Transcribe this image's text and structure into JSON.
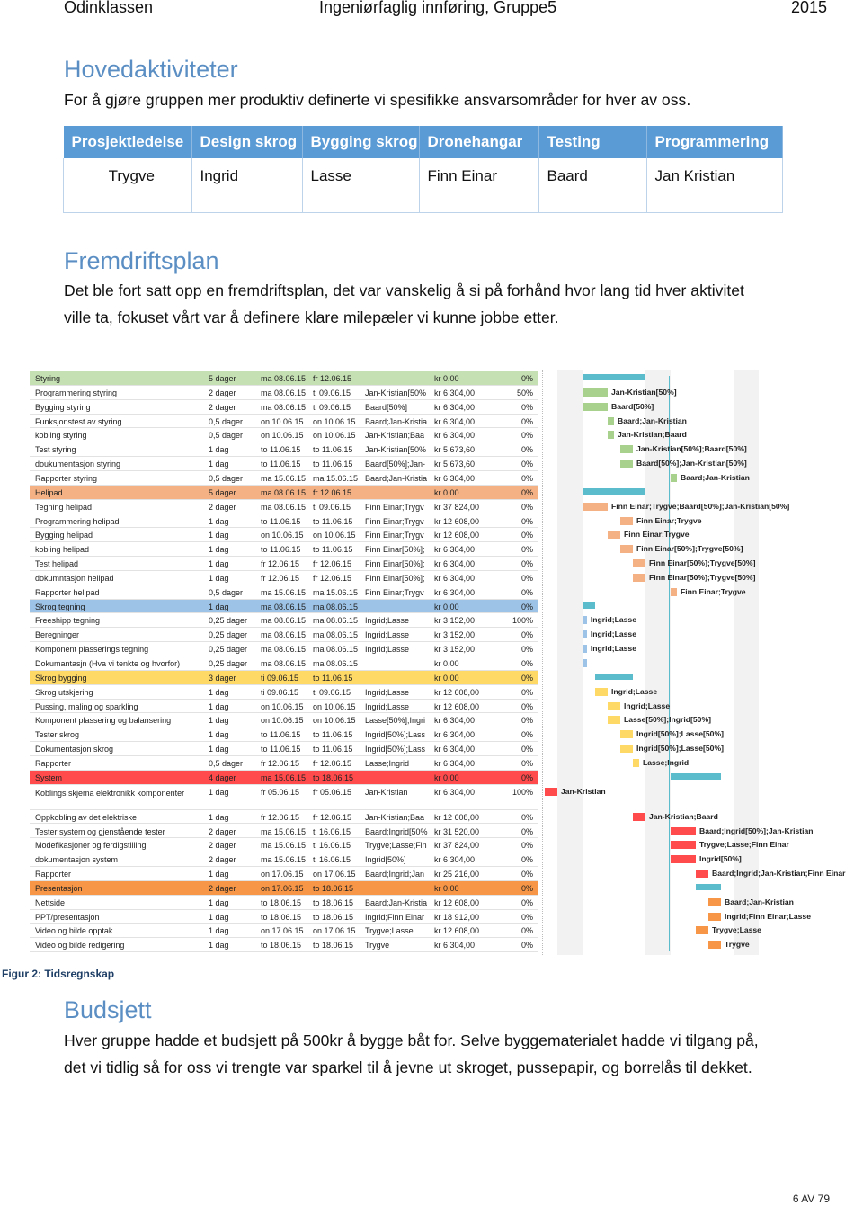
{
  "header": {
    "left": "Odinklassen",
    "center": "Ingeniørfaglig innføring, Gruppe5",
    "right": "2015"
  },
  "section1": {
    "title": "Hovedaktiviteter",
    "text": "For å gjøre gruppen mer produktiv definerte vi spesifikke ansvarsområder for hver av oss.",
    "table": {
      "headers": [
        "Prosjektledelse",
        "Design skrog",
        "Bygging skrog",
        "Dronehangar",
        "Testing",
        "Programmering"
      ],
      "values": [
        "Trygve",
        "Ingrid",
        "Lasse",
        "Finn Einar",
        "Baard",
        "Jan Kristian"
      ]
    }
  },
  "section2": {
    "title": "Fremdriftsplan",
    "lines": [
      "Det ble fort satt opp en fremdriftsplan, det var vanskelig å si på forhånd hvor lang tid hver aktivitet",
      "ville ta, fokuset vårt var å definere klare milepæler vi kunne jobbe etter."
    ]
  },
  "figure": {
    "caption": "Figur 2: Tidsregnskap"
  },
  "chart_data": {
    "type": "table",
    "colors": {
      "green": "#a9d18e",
      "orange": "#f4b183",
      "blue": "#9dc3e6",
      "yellow": "#ffd966",
      "red": "#ff4b4b",
      "darkorange": "#f79646",
      "summary_bar": "#5bbccb"
    },
    "rows": [
      {
        "name": "Styring",
        "dur": "5 dager",
        "start": "ma 08.06.15",
        "finish": "fr 12.06.15",
        "res": "",
        "cost": "kr 0,00",
        "pct": "0%",
        "summary": true,
        "group": "green",
        "label": ""
      },
      {
        "name": "Programmering styring",
        "dur": "2 dager",
        "start": "ma 08.06.15",
        "finish": "ti 09.06.15",
        "res": "Jan-Kristian[50%",
        "cost": "kr 6 304,00",
        "pct": "50%",
        "group": "green",
        "label": "Jan-Kristian[50%]"
      },
      {
        "name": "Bygging styring",
        "dur": "2 dager",
        "start": "ma 08.06.15",
        "finish": "ti 09.06.15",
        "res": "Baard[50%]",
        "cost": "kr 6 304,00",
        "pct": "0%",
        "group": "green",
        "label": "Baard[50%]"
      },
      {
        "name": "Funksjonstest av styring",
        "dur": "0,5 dager",
        "start": "on 10.06.15",
        "finish": "on 10.06.15",
        "res": "Baard;Jan-Kristia",
        "cost": "kr 6 304,00",
        "pct": "0%",
        "group": "green",
        "label": "Baard;Jan-Kristian"
      },
      {
        "name": "kobling styring",
        "dur": "0,5 dager",
        "start": "on 10.06.15",
        "finish": "on 10.06.15",
        "res": "Jan-Kristian;Baa",
        "cost": "kr 6 304,00",
        "pct": "0%",
        "group": "green",
        "label": "Jan-Kristian;Baard"
      },
      {
        "name": "Test styring",
        "dur": "1 dag",
        "start": "to 11.06.15",
        "finish": "to 11.06.15",
        "res": "Jan-Kristian[50%",
        "cost": "kr 5 673,60",
        "pct": "0%",
        "group": "green",
        "label": "Jan-Kristian[50%];Baard[50%]"
      },
      {
        "name": "doukumentasjon styring",
        "dur": "1 dag",
        "start": "to 11.06.15",
        "finish": "to 11.06.15",
        "res": "Baard[50%];Jan-",
        "cost": "kr 5 673,60",
        "pct": "0%",
        "group": "green",
        "label": "Baard[50%];Jan-Kristian[50%]"
      },
      {
        "name": "Rapporter styring",
        "dur": "0,5 dager",
        "start": "ma 15.06.15",
        "finish": "ma 15.06.15",
        "res": "Baard;Jan-Kristia",
        "cost": "kr 6 304,00",
        "pct": "0%",
        "group": "green",
        "label": "Baard;Jan-Kristian"
      },
      {
        "name": "Helipad",
        "dur": "5 dager",
        "start": "ma 08.06.15",
        "finish": "fr 12.06.15",
        "res": "",
        "cost": "kr 0,00",
        "pct": "0%",
        "summary": true,
        "group": "orange",
        "label": ""
      },
      {
        "name": "Tegning helipad",
        "dur": "2 dager",
        "start": "ma 08.06.15",
        "finish": "ti 09.06.15",
        "res": "Finn Einar;Trygv",
        "cost": "kr 37 824,00",
        "pct": "0%",
        "group": "orange",
        "label": "Finn Einar;Trygve;Baard[50%];Jan-Kristian[50%]"
      },
      {
        "name": "Programmering helipad",
        "dur": "1 dag",
        "start": "to 11.06.15",
        "finish": "to 11.06.15",
        "res": "Finn Einar;Trygv",
        "cost": "kr 12 608,00",
        "pct": "0%",
        "group": "orange",
        "label": "Finn Einar;Trygve"
      },
      {
        "name": "Bygging helipad",
        "dur": "1 dag",
        "start": "on 10.06.15",
        "finish": "on 10.06.15",
        "res": "Finn Einar;Trygv",
        "cost": "kr 12 608,00",
        "pct": "0%",
        "group": "orange",
        "label": "Finn Einar;Trygve"
      },
      {
        "name": "kobling helipad",
        "dur": "1 dag",
        "start": "to 11.06.15",
        "finish": "to 11.06.15",
        "res": "Finn Einar[50%];",
        "cost": "kr 6 304,00",
        "pct": "0%",
        "group": "orange",
        "label": "Finn Einar[50%];Trygve[50%]"
      },
      {
        "name": "Test helipad",
        "dur": "1 dag",
        "start": "fr 12.06.15",
        "finish": "fr 12.06.15",
        "res": "Finn Einar[50%];",
        "cost": "kr 6 304,00",
        "pct": "0%",
        "group": "orange",
        "label": "Finn Einar[50%];Trygve[50%]"
      },
      {
        "name": "dokumntasjon helipad",
        "dur": "1 dag",
        "start": "fr 12.06.15",
        "finish": "fr 12.06.15",
        "res": "Finn Einar[50%];",
        "cost": "kr 6 304,00",
        "pct": "0%",
        "group": "orange",
        "label": "Finn Einar[50%];Trygve[50%]"
      },
      {
        "name": "Rapporter helipad",
        "dur": "0,5 dager",
        "start": "ma 15.06.15",
        "finish": "ma 15.06.15",
        "res": "Finn Einar;Trygv",
        "cost": "kr 6 304,00",
        "pct": "0%",
        "group": "orange",
        "label": "Finn Einar;Trygve"
      },
      {
        "name": "Skrog tegning",
        "dur": "1 dag",
        "start": "ma 08.06.15",
        "finish": "ma 08.06.15",
        "res": "",
        "cost": "kr 0,00",
        "pct": "0%",
        "summary": true,
        "group": "blue",
        "label": ""
      },
      {
        "name": "Freeshipp tegning",
        "dur": "0,25 dager",
        "start": "ma 08.06.15",
        "finish": "ma 08.06.15",
        "res": "Ingrid;Lasse",
        "cost": "kr 3 152,00",
        "pct": "100%",
        "group": "blue",
        "label": "Ingrid;Lasse"
      },
      {
        "name": "Beregninger",
        "dur": "0,25 dager",
        "start": "ma 08.06.15",
        "finish": "ma 08.06.15",
        "res": "Ingrid;Lasse",
        "cost": "kr 3 152,00",
        "pct": "0%",
        "group": "blue",
        "label": "Ingrid;Lasse"
      },
      {
        "name": "Komponent plasserings tegning",
        "dur": "0,25 dager",
        "start": "ma 08.06.15",
        "finish": "ma 08.06.15",
        "res": "Ingrid;Lasse",
        "cost": "kr 3 152,00",
        "pct": "0%",
        "group": "blue",
        "label": "Ingrid;Lasse"
      },
      {
        "name": "Dokumantasjn (Hva vi tenkte og hvorfor)",
        "dur": "0,25 dager",
        "start": "ma 08.06.15",
        "finish": "ma 08.06.15",
        "res": "",
        "cost": "kr 0,00",
        "pct": "0%",
        "group": "blue",
        "label": ""
      },
      {
        "name": "Skrog bygging",
        "dur": "3 dager",
        "start": "ti 09.06.15",
        "finish": "to 11.06.15",
        "res": "",
        "cost": "kr 0,00",
        "pct": "0%",
        "summary": true,
        "group": "yellow",
        "label": ""
      },
      {
        "name": "Skrog utskjering",
        "dur": "1 dag",
        "start": "ti 09.06.15",
        "finish": "ti 09.06.15",
        "res": "Ingrid;Lasse",
        "cost": "kr 12 608,00",
        "pct": "0%",
        "group": "yellow",
        "label": "Ingrid;Lasse"
      },
      {
        "name": "Pussing, maling og sparkling",
        "dur": "1 dag",
        "start": "on 10.06.15",
        "finish": "on 10.06.15",
        "res": "Ingrid;Lasse",
        "cost": "kr 12 608,00",
        "pct": "0%",
        "group": "yellow",
        "label": "Ingrid;Lasse"
      },
      {
        "name": "Komponent plassering og balansering",
        "dur": "1 dag",
        "start": "on 10.06.15",
        "finish": "on 10.06.15",
        "res": "Lasse[50%];Ingri",
        "cost": "kr 6 304,00",
        "pct": "0%",
        "group": "yellow",
        "label": "Lasse[50%];Ingrid[50%]"
      },
      {
        "name": "Tester skrog",
        "dur": "1 dag",
        "start": "to 11.06.15",
        "finish": "to 11.06.15",
        "res": "Ingrid[50%];Lass",
        "cost": "kr 6 304,00",
        "pct": "0%",
        "group": "yellow",
        "label": "Ingrid[50%];Lasse[50%]"
      },
      {
        "name": "Dokumentasjon skrog",
        "dur": "1 dag",
        "start": "to 11.06.15",
        "finish": "to 11.06.15",
        "res": "Ingrid[50%];Lass",
        "cost": "kr 6 304,00",
        "pct": "0%",
        "group": "yellow",
        "label": "Ingrid[50%];Lasse[50%]"
      },
      {
        "name": "Rapporter",
        "dur": "0,5 dager",
        "start": "fr 12.06.15",
        "finish": "fr 12.06.15",
        "res": "Lasse;Ingrid",
        "cost": "kr 6 304,00",
        "pct": "0%",
        "group": "yellow",
        "label": "Lasse;Ingrid"
      },
      {
        "name": "System",
        "dur": "4 dager",
        "start": "ma 15.06.15",
        "finish": "to 18.06.15",
        "res": "",
        "cost": "kr 0,00",
        "pct": "0%",
        "summary": true,
        "group": "red",
        "label": ""
      },
      {
        "name": "Koblings skjema elektronikk komponenter",
        "dur": "1 dag",
        "start": "fr 05.06.15",
        "finish": "fr 05.06.15",
        "res": "Jan-Kristian",
        "cost": "kr 6 304,00",
        "pct": "100%",
        "group": "red",
        "label": "Jan-Kristian",
        "tall": true
      },
      {
        "name": "Oppkobling av det elektriske",
        "dur": "1 dag",
        "start": "fr 12.06.15",
        "finish": "fr 12.06.15",
        "res": "Jan-Kristian;Baa",
        "cost": "kr 12 608,00",
        "pct": "0%",
        "group": "red",
        "label": "Jan-Kristian;Baard"
      },
      {
        "name": "Tester system og gjenstående tester",
        "dur": "2 dager",
        "start": "ma 15.06.15",
        "finish": "ti 16.06.15",
        "res": "Baard;Ingrid[50%",
        "cost": "kr 31 520,00",
        "pct": "0%",
        "group": "red",
        "label": "Baard;Ingrid[50%];Jan-Kristian"
      },
      {
        "name": "Modefikasjoner og ferdigstilling",
        "dur": "2 dager",
        "start": "ma 15.06.15",
        "finish": "ti 16.06.15",
        "res": "Trygve;Lasse;Fin",
        "cost": "kr 37 824,00",
        "pct": "0%",
        "group": "red",
        "label": "Trygve;Lasse;Finn Einar"
      },
      {
        "name": "dokumentasjon system",
        "dur": "2 dager",
        "start": "ma 15.06.15",
        "finish": "ti 16.06.15",
        "res": "Ingrid[50%]",
        "cost": "kr 6 304,00",
        "pct": "0%",
        "group": "red",
        "label": "Ingrid[50%]"
      },
      {
        "name": "Rapporter",
        "dur": "1 dag",
        "start": "on 17.06.15",
        "finish": "on 17.06.15",
        "res": "Baard;Ingrid;Jan",
        "cost": "kr 25 216,00",
        "pct": "0%",
        "group": "red",
        "label": "Baard;Ingrid;Jan-Kristian;Finn Einar"
      },
      {
        "name": "Presentasjon",
        "dur": "2 dager",
        "start": "on 17.06.15",
        "finish": "to 18.06.15",
        "res": "",
        "cost": "kr 0,00",
        "pct": "0%",
        "summary": true,
        "group": "darkorange",
        "label": ""
      },
      {
        "name": "Nettside",
        "dur": "1 dag",
        "start": "to 18.06.15",
        "finish": "to 18.06.15",
        "res": "Baard;Jan-Kristia",
        "cost": "kr 12 608,00",
        "pct": "0%",
        "group": "darkorange",
        "label": "Baard;Jan-Kristian"
      },
      {
        "name": "PPT/presentasjon",
        "dur": "1 dag",
        "start": "to 18.06.15",
        "finish": "to 18.06.15",
        "res": "Ingrid;Finn Einar",
        "cost": "kr 18 912,00",
        "pct": "0%",
        "group": "darkorange",
        "label": "Ingrid;Finn Einar;Lasse"
      },
      {
        "name": "Video og bilde opptak",
        "dur": "1 dag",
        "start": "on 17.06.15",
        "finish": "on 17.06.15",
        "res": "Trygve;Lasse",
        "cost": "kr 12 608,00",
        "pct": "0%",
        "group": "darkorange",
        "label": "Trygve;Lasse"
      },
      {
        "name": "Video og bilde redigering",
        "dur": "1 dag",
        "start": "to 18.06.15",
        "finish": "to 18.06.15",
        "res": "Trygve",
        "cost": "kr 6 304,00",
        "pct": "0%",
        "group": "darkorange",
        "label": "Trygve"
      }
    ]
  },
  "section3": {
    "title": "Budsjett",
    "lines": [
      "Hver gruppe hadde et budsjett på 500kr å bygge båt for. Selve byggematerialet hadde vi tilgang på,",
      "det vi tidlig så for oss vi trengte var sparkel til å jevne ut skroget, pussepapir, og borrelås til dekket."
    ]
  },
  "footer": {
    "page": "6 AV 79"
  }
}
